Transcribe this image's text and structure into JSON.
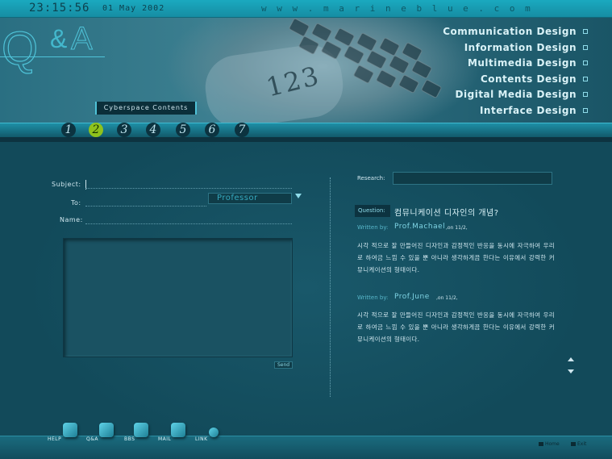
{
  "header": {
    "clock": "23:15:56",
    "date": "01 May 2002",
    "site_url": "w w w . m a r i n e b l u e . c o m"
  },
  "logo": {
    "q": "Q",
    "amp": "&",
    "a": "A"
  },
  "hero": {
    "digits": "123",
    "tagline": "Cyberspace Contents"
  },
  "menu": [
    {
      "label": "Communication Design"
    },
    {
      "label": "Information Design"
    },
    {
      "label": "Multimedia Design"
    },
    {
      "label": "Contents Design"
    },
    {
      "label": "Digital Media Design"
    },
    {
      "label": "Interface Design"
    }
  ],
  "pages": [
    "1",
    "2",
    "3",
    "4",
    "5",
    "6",
    "7"
  ],
  "active_page": "2",
  "form": {
    "subject_label": "Subject:",
    "subject_value": "",
    "to_label": "To:",
    "to_selected": "Professor",
    "name_label": "Name:",
    "name_value": "",
    "message_value": "",
    "send_label": "Send"
  },
  "research": {
    "label": "Research:",
    "value": ""
  },
  "question": {
    "label": "Question:",
    "text": "컴뮤니케이션 디자인의 개념?"
  },
  "answers": [
    {
      "written_label": "Written by:",
      "author": "Prof.Machael",
      "on": ",on 11/2,",
      "text": "시각 적으로 잘 만들어진 디자인과 감정적인 반응을 동시에 자극하여 우리로 하여금 느낌 수 있을 뿐 아니라 생각하게끔 한다는 이유에서 강력한 커뮤니케이션의 형태이다."
    },
    {
      "written_label": "Written by:",
      "author": "Prof.June",
      "on": ",on 11/2,",
      "text": "시각 적으로 잘 만들어진 디자인과 감정적인 반응을 동시에 자극하여 우리로 하여금 느낌 수 있을 뿐 아니라 생각하게끔 한다는 이유에서 강력한 커뮤니케이션의 형태이다."
    }
  ],
  "footer": {
    "items": [
      {
        "label": "HELP"
      },
      {
        "label": "Q&A"
      },
      {
        "label": "BBS"
      },
      {
        "label": "MAIL"
      },
      {
        "label": "LINK"
      }
    ],
    "home_label": "Home",
    "exit_label": "Exit"
  },
  "colors": {
    "accent": "#4fc3d8",
    "active_page": "#8fc21c",
    "background": "#124a5a"
  }
}
